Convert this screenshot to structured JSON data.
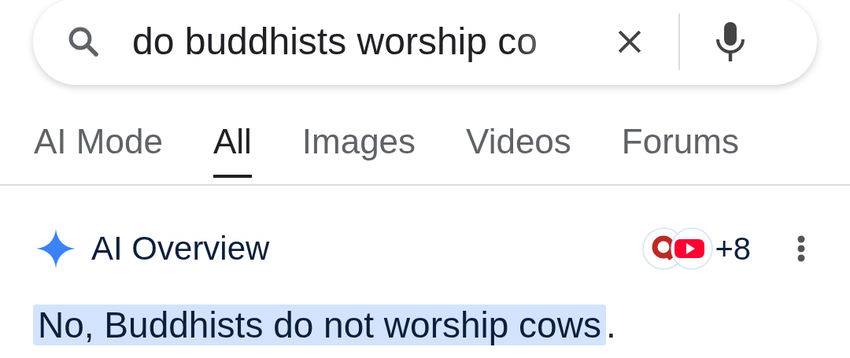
{
  "search": {
    "value": "do buddhists worship co"
  },
  "tabs": [
    {
      "label": "AI Mode",
      "selected": false
    },
    {
      "label": "All",
      "selected": true
    },
    {
      "label": "Images",
      "selected": false
    },
    {
      "label": "Videos",
      "selected": false
    },
    {
      "label": "Forums",
      "selected": false
    }
  ],
  "overview": {
    "title": "AI Overview",
    "sources_count": "+8"
  },
  "answer": {
    "highlighted": "No, Buddhists do not worship cows",
    "rest": "."
  }
}
